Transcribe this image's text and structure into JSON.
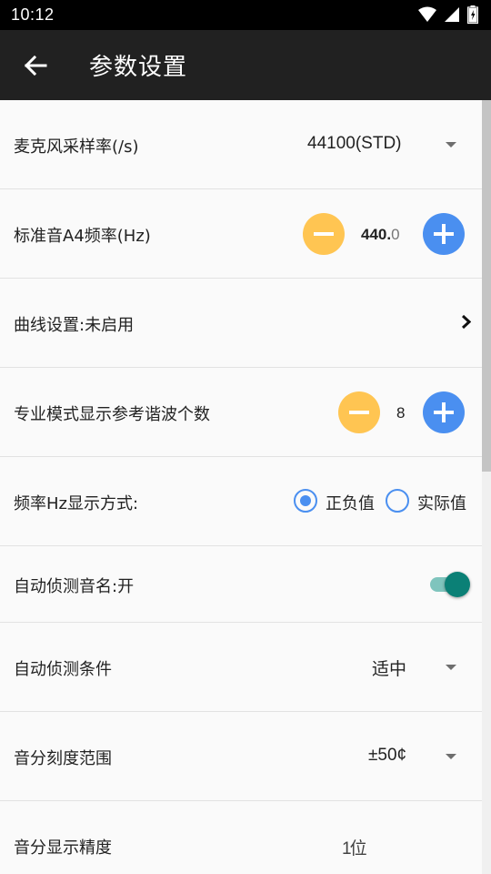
{
  "status_bar": {
    "time": "10:12",
    "icons": [
      "wifi-icon",
      "signal-icon",
      "battery-icon"
    ]
  },
  "app_bar": {
    "title": "参数设置",
    "back_icon": "arrow-left-icon"
  },
  "settings": {
    "mic_sample_rate": {
      "label": "麦克风采样率(/s)",
      "value": "44100(STD)"
    },
    "a4_frequency": {
      "label": "标准音A4频率(Hz)",
      "value_int": "440.",
      "value_dec": "0"
    },
    "curve_settings": {
      "label": "曲线设置:未启用"
    },
    "harmonics_count": {
      "label": "专业模式显示参考谐波个数",
      "value": "8"
    },
    "freq_display_mode": {
      "label": "频率Hz显示方式:",
      "options": [
        "正负值",
        "实际值"
      ],
      "selected": "正负值"
    },
    "auto_detect_note": {
      "label": "自动侦测音名:开",
      "on": true
    },
    "auto_detect_condition": {
      "label": "自动侦测条件",
      "value": "适中"
    },
    "cent_scale_range": {
      "label": "音分刻度范围",
      "value": "±50¢"
    },
    "cent_precision": {
      "label": "音分显示精度",
      "value": "1位"
    }
  },
  "colors": {
    "minus": "#ffc552",
    "plus": "#4a8ff0",
    "switch_thumb": "#0b8076",
    "switch_track": "#7fc4bd",
    "app_bar": "#212121"
  }
}
